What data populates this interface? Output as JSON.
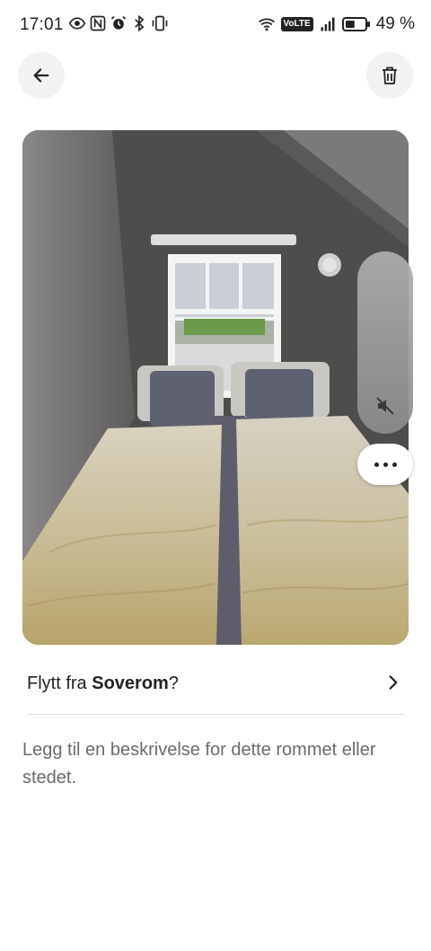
{
  "status_bar": {
    "time": "17:01",
    "left_icons": [
      "eye-icon",
      "nfc-icon",
      "alarm-icon",
      "bluetooth-icon",
      "vibrate-icon"
    ],
    "network_badge": "VoLTE",
    "battery_percent": "49 %",
    "battery_level": 0.49
  },
  "header": {
    "back_icon": "arrow-left-icon",
    "delete_icon": "trash-icon"
  },
  "photo": {
    "subject": "bedroom-photo",
    "volume_icon": "mute-icon",
    "more_icon": "more-horizontal-icon"
  },
  "move_row": {
    "prefix": "Flytt fra ",
    "room": "Soverom",
    "suffix": "?"
  },
  "description": {
    "placeholder": "Legg til en beskrivelse for dette rommet eller stedet."
  },
  "colors": {
    "text": "#222222",
    "muted_text": "#6a6a6a",
    "button_bg": "#f2f2f2",
    "divider": "#dddddd"
  }
}
